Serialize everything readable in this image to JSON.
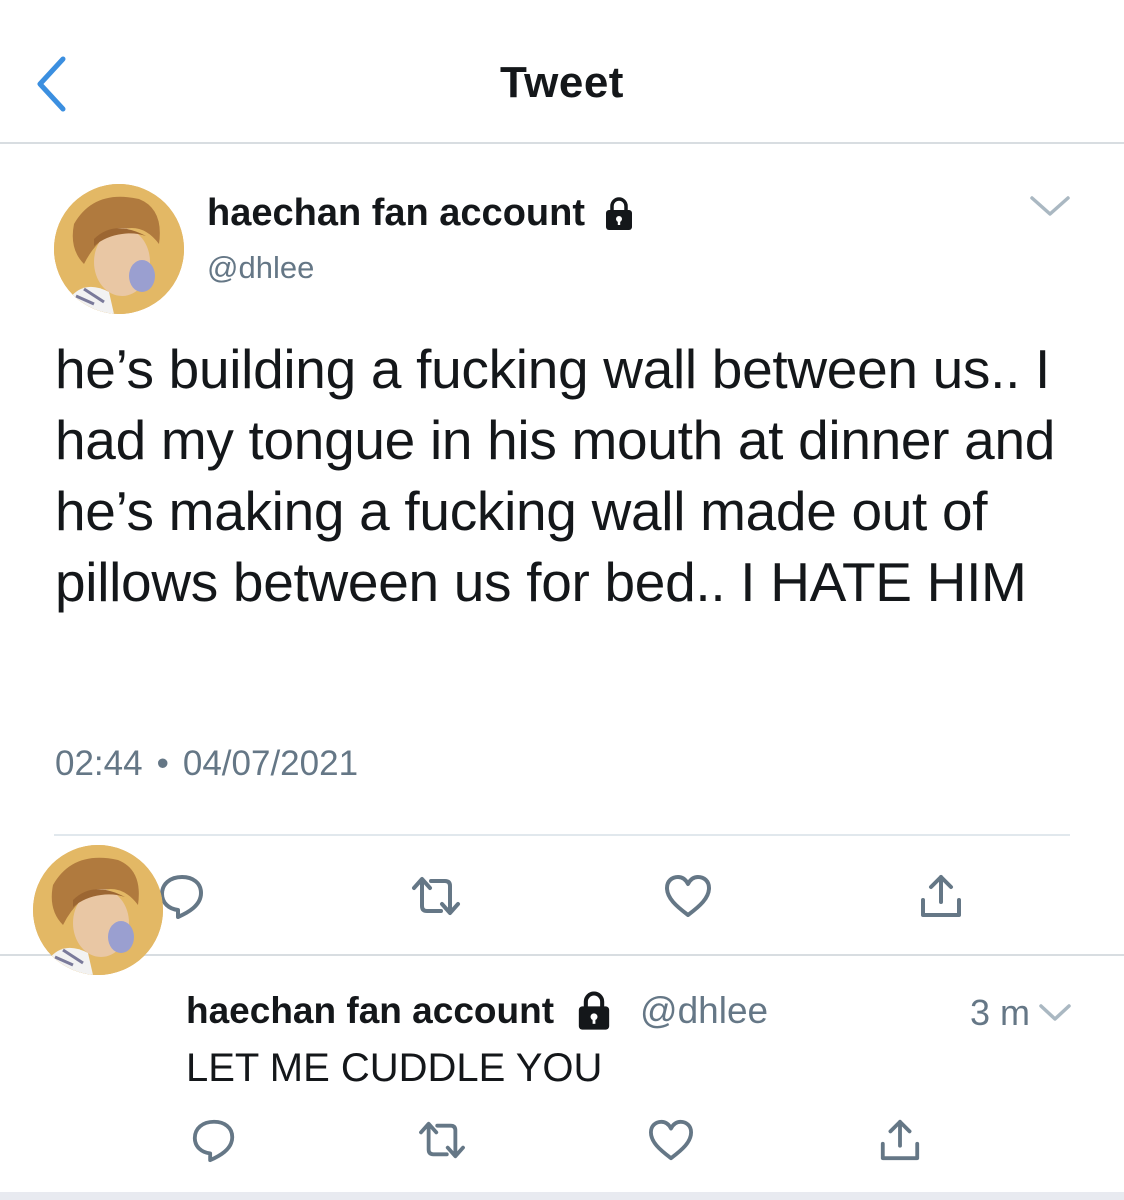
{
  "header": {
    "title": "Tweet",
    "back_icon": "chevron-left-icon",
    "accent_color": "#3b8fe0"
  },
  "tweet": {
    "author_name": "haechan fan account",
    "protected_icon": "lock-icon",
    "handle": "@dhlee",
    "text": "he’s building a fucking wall between us.. I had my tongue in his mouth at dinner and he’s making a fucking wall made out of pillows between us for bed.. I HATE HIM",
    "time": "02:44",
    "separator": "•",
    "date": "04/07/2021",
    "actions": [
      "reply-icon",
      "retweet-icon",
      "like-icon",
      "share-icon"
    ]
  },
  "reply": {
    "author_name": "haechan fan account",
    "protected_icon": "lock-icon",
    "handle": "@dhlee",
    "time": "3 m",
    "text": "LET ME CUDDLE YOU",
    "actions": [
      "reply-icon",
      "retweet-icon",
      "like-icon",
      "share-icon"
    ]
  }
}
